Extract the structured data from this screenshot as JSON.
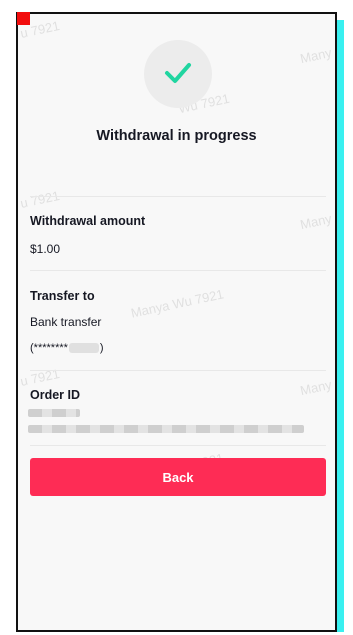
{
  "status": {
    "icon": "check-icon",
    "title": "Withdrawal in progress",
    "accent_color": "#20d5a0"
  },
  "withdrawal": {
    "label": "Withdrawal amount",
    "value": "$1.00"
  },
  "transfer": {
    "label": "Transfer to",
    "method": "Bank transfer",
    "account_prefix": "(********",
    "account_suffix": ")"
  },
  "order": {
    "label": "Order ID"
  },
  "actions": {
    "back_label": "Back",
    "button_color": "#fe2c55"
  },
  "watermarks": [
    "u 7921",
    "Wu 7921",
    "Many",
    "u 7921",
    "Many",
    "Manya Wu 7921",
    "u 7921",
    "Many",
    "Manya Wu 7921"
  ]
}
